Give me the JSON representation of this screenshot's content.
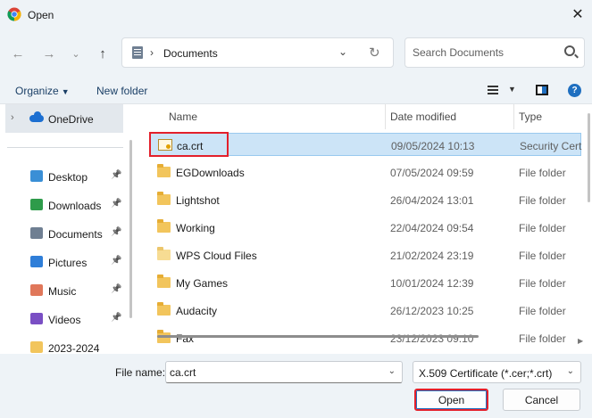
{
  "window": {
    "title": "Open"
  },
  "nav": {
    "back_icon": "arrow-left-icon",
    "forward_icon": "arrow-right-icon",
    "recent_icon": "chevron-down-icon",
    "up_icon": "arrow-up-icon"
  },
  "address": {
    "path": "Documents"
  },
  "search": {
    "placeholder": "Search Documents"
  },
  "toolbar": {
    "organize": "Organize",
    "new_folder": "New folder"
  },
  "sidebar": {
    "onedrive": "OneDrive",
    "items": [
      {
        "label": "Desktop",
        "icon": "desktop-icon",
        "color": "#3a8fd6",
        "pinned": true
      },
      {
        "label": "Downloads",
        "icon": "download-icon",
        "color": "#2e9b4a",
        "pinned": true
      },
      {
        "label": "Documents",
        "icon": "document-icon",
        "color": "#6f7f92",
        "pinned": true
      },
      {
        "label": "Pictures",
        "icon": "picture-icon",
        "color": "#2f7ed8",
        "pinned": true
      },
      {
        "label": "Music",
        "icon": "music-icon",
        "color": "#e0775a",
        "pinned": true
      },
      {
        "label": "Videos",
        "icon": "video-icon",
        "color": "#7a4fc4",
        "pinned": true
      },
      {
        "label": "2023-2024",
        "icon": "folder-icon",
        "color": "#f2c55c",
        "pinned": false
      }
    ]
  },
  "columns": {
    "name": "Name",
    "date": "Date modified",
    "type": "Type"
  },
  "files": [
    {
      "name": "ca.crt",
      "date": "09/05/2024 10:13",
      "type": "Security Certificate",
      "kind": "cert"
    },
    {
      "name": "EGDownloads",
      "date": "07/05/2024 09:59",
      "type": "File folder",
      "kind": "folder"
    },
    {
      "name": "Lightshot",
      "date": "26/04/2024 13:01",
      "type": "File folder",
      "kind": "folder"
    },
    {
      "name": "Working",
      "date": "22/04/2024 09:54",
      "type": "File folder",
      "kind": "folder"
    },
    {
      "name": "WPS Cloud Files",
      "date": "21/02/2024 23:19",
      "type": "File folder",
      "kind": "folder-light"
    },
    {
      "name": "My Games",
      "date": "10/01/2024 12:39",
      "type": "File folder",
      "kind": "folder"
    },
    {
      "name": "Audacity",
      "date": "26/12/2023 10:25",
      "type": "File folder",
      "kind": "folder"
    },
    {
      "name": "Fax",
      "date": "23/12/2023 09:10",
      "type": "File folder",
      "kind": "folder"
    }
  ],
  "footer": {
    "filename_label": "File name:",
    "filename_value": "ca.crt",
    "filetype": "X.509 Certificate (*.cer;*.crt)",
    "open": "Open",
    "cancel": "Cancel"
  },
  "colors": {
    "selection": "#cce4f7",
    "highlight": "#e3202b",
    "accent": "#1f6fc0"
  }
}
